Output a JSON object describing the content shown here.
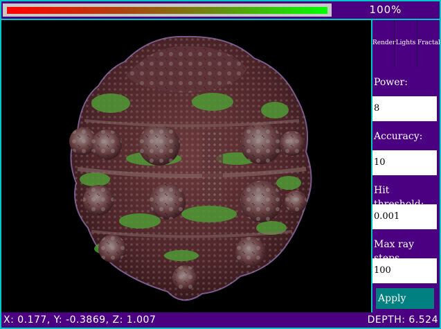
{
  "progress": {
    "percent": 1.0,
    "label": "100%"
  },
  "tabs": [
    "Render",
    "Lights",
    "Fractal"
  ],
  "fields": [
    {
      "label": "Power:",
      "value": "8"
    },
    {
      "label": "Accuracy:",
      "value": "10"
    },
    {
      "label": "Hit threshold:",
      "value": "0.001"
    },
    {
      "label": "Max ray steps",
      "value": "100"
    }
  ],
  "apply_label": "Apply",
  "status": {
    "coords": "X: 0.177, Y: -0.3869, Z: 1.007",
    "depth": "DEPTH: 6.524"
  },
  "colors": {
    "panel": "#4b0082",
    "frame": "#00c8c8",
    "apply": "#008080",
    "fractal_body": "#5a2f32",
    "fractal_green": "#4f9a35"
  }
}
